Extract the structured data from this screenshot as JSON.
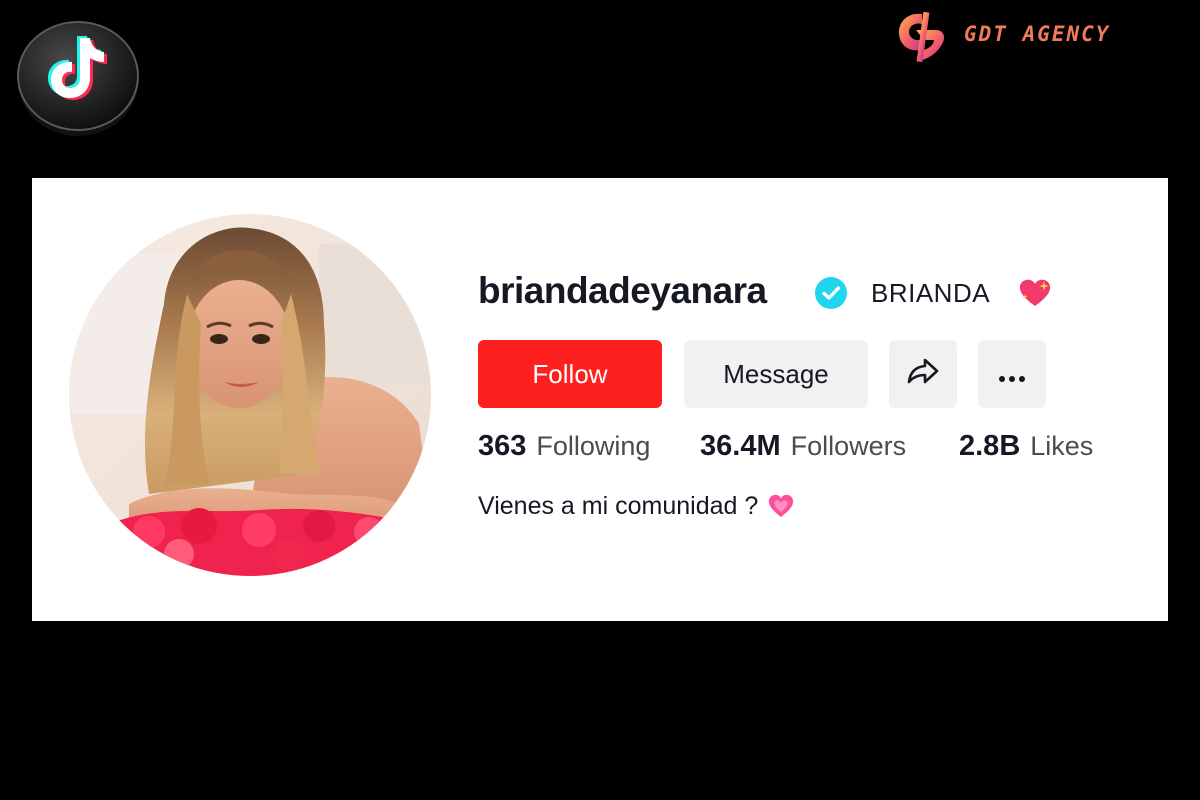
{
  "branding": {
    "app_logo_icon": "tiktok-logo-icon",
    "agency_mark_icon": "gdt-agency-mark-icon",
    "agency_name": "GDT AGENCY",
    "agency_color": "#f07a5a"
  },
  "profile": {
    "avatar_icon": "profile-photo",
    "username": "briandadeyanara",
    "verified_icon": "verified-badge-icon",
    "verified_color": "#20d5ec",
    "nickname": "BRIANDA",
    "nickname_emoji_icon": "sparkling-heart-icon",
    "buttons": {
      "follow_label": "Follow",
      "message_label": "Message",
      "share_icon": "share-arrow-icon",
      "more_icon": "more-dots-icon"
    },
    "stats": {
      "following_count": "363",
      "following_label": "Following",
      "followers_count": "36.4M",
      "followers_label": "Followers",
      "likes_count": "2.8B",
      "likes_label": "Likes"
    },
    "bio": "Vienes a mi comunidad ?",
    "bio_emoji_icon": "pink-heart-icon"
  },
  "colors": {
    "follow_button": "#fe1f1f",
    "secondary_button": "#f1f1f2",
    "text_primary": "#161823",
    "text_secondary": "#4a4b53"
  }
}
